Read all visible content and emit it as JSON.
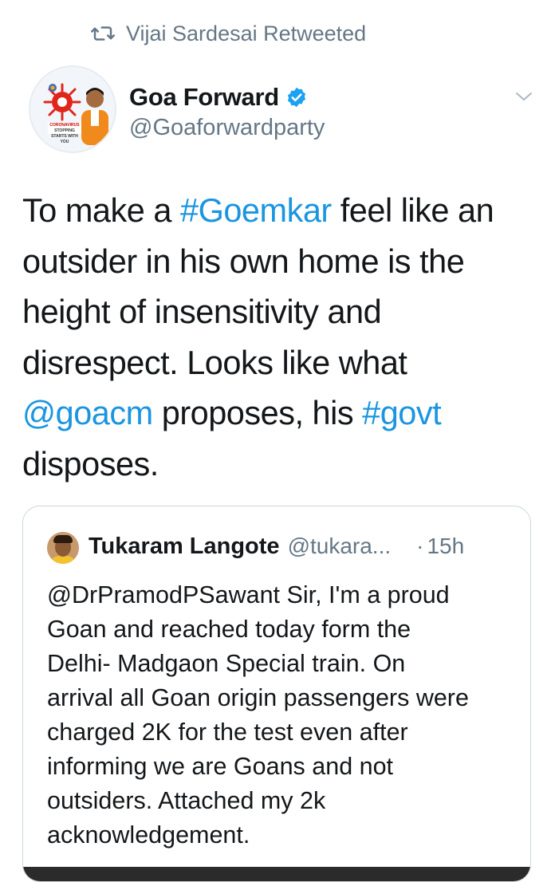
{
  "social_context": {
    "label": "Vijai Sardesai Retweeted",
    "icon": "retweet-icon"
  },
  "author": {
    "display_name": "Goa Forward",
    "handle": "@Goaforwardparty",
    "verified": true,
    "avatar_caption": "STOPPING STARTS WITH YOU",
    "avatar_caption_top": "CORONAVIRUS"
  },
  "tweet": {
    "lines": [
      [
        {
          "t": "To make a ",
          "link": false
        },
        {
          "t": "#Goemkar",
          "link": true
        },
        {
          "t": " feel like an",
          "link": false
        }
      ],
      [
        {
          "t": "outsider in his own home is the",
          "link": false
        }
      ],
      [
        {
          "t": "height of insensitivity and",
          "link": false
        }
      ],
      [
        {
          "t": "disrespect. Looks like what",
          "link": false
        }
      ],
      [
        {
          "t": "@goacm",
          "link": true
        },
        {
          "t": " proposes, his ",
          "link": false
        },
        {
          "t": "#govt",
          "link": true
        }
      ],
      [
        {
          "t": "disposes.",
          "link": false
        }
      ]
    ]
  },
  "quoted_tweet": {
    "display_name": "Tukaram Langote",
    "handle": "@tukara...",
    "separator": "·",
    "time": "15h",
    "lines": [
      "@DrPramodPSawant  Sir, I'm a proud",
      "Goan and reached today form the",
      "Delhi- Madgaon Special train. On",
      "arrival all Goan origin passengers were",
      "charged 2K for the test even after",
      "informing we are Goans and not",
      "outsiders. Attached my 2k",
      "acknowledgement."
    ]
  },
  "colors": {
    "link": "#1b95e0",
    "secondary": "#657786",
    "text": "#14171a",
    "border": "#ccd6dd"
  }
}
